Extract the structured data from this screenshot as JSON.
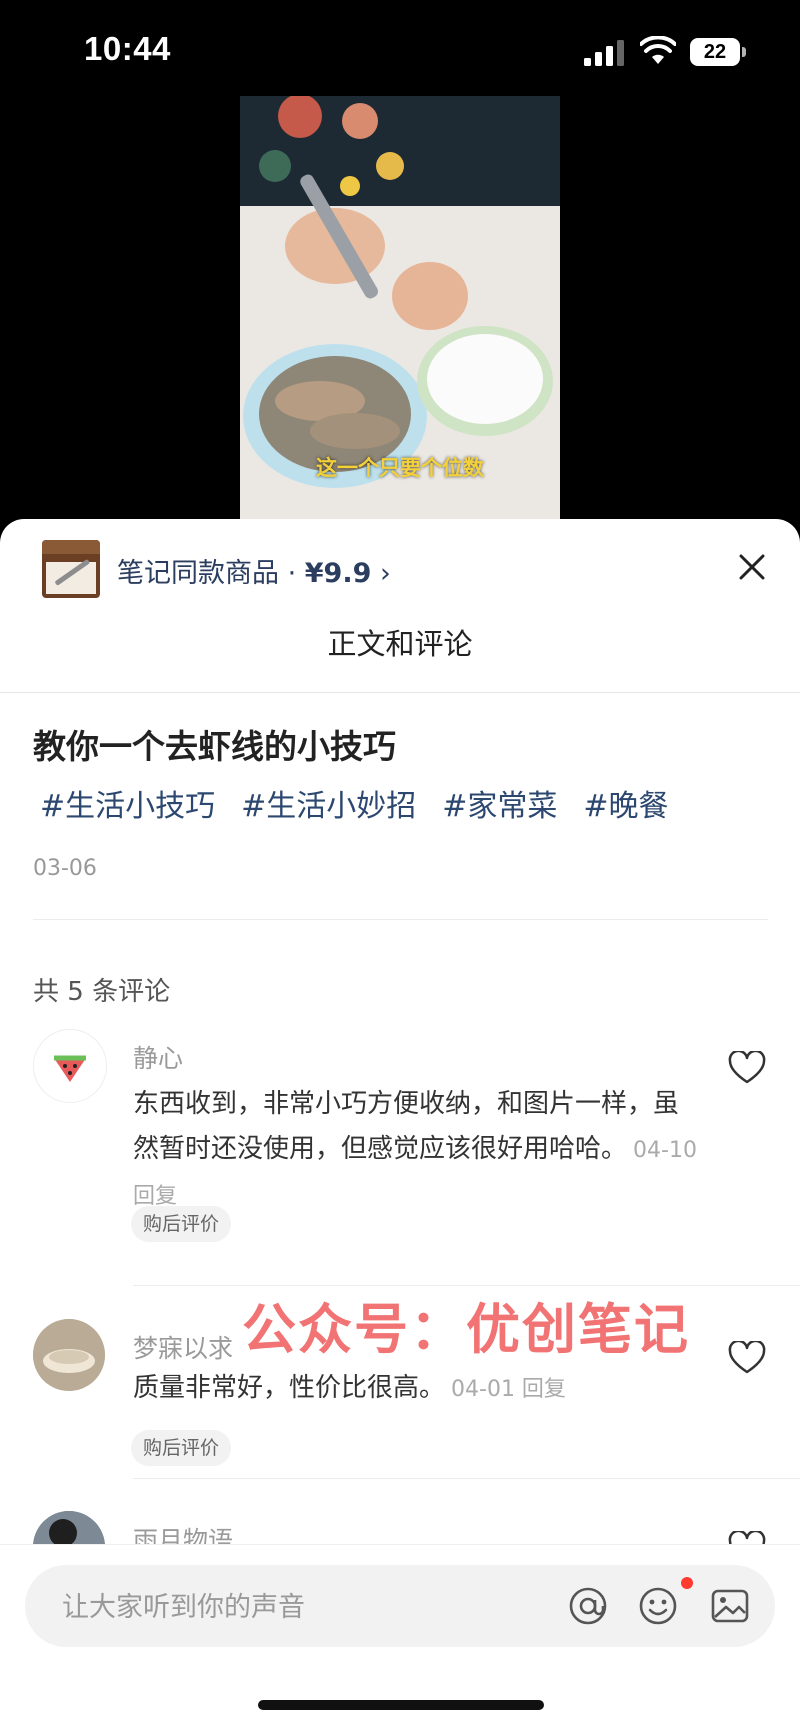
{
  "status": {
    "time": "10:44",
    "battery": "22"
  },
  "video": {
    "caption": "这一个只要个位数"
  },
  "product": {
    "label": "笔记同款商品 · ",
    "price": "¥9.9",
    "arrow": "›"
  },
  "sheet": {
    "title": "正文和评论"
  },
  "post": {
    "title": "教你一个去虾线的小技巧",
    "tags": [
      "#生活小技巧",
      "#生活小妙招",
      "#家常菜",
      "#晚餐"
    ],
    "date": "03-06"
  },
  "comments_header": "共 5 条评论",
  "comments": [
    {
      "author": "静心",
      "text": "东西收到，非常小巧方便收纳，和图片一样，虽然暂时还没使用，但感觉应该很好用哈哈。",
      "meta": "04-10 回复",
      "badge": "购后评价"
    },
    {
      "author": "梦寐以求",
      "text": "质量非常好，性价比很高。",
      "meta": "04-01 回复",
      "badge": "购后评价"
    },
    {
      "author": "雨月物语"
    }
  ],
  "watermark": "公众号：优创笔记",
  "input": {
    "placeholder": "让大家听到你的声音"
  },
  "icons": [
    "signal-icon",
    "wifi-icon",
    "battery-icon",
    "close-icon",
    "heart-icon",
    "at-icon",
    "emoji-icon",
    "image-icon"
  ],
  "colors": {
    "link": "#2c4870",
    "notification_dot": "#ff3b30",
    "watermark": "#ee5050"
  }
}
